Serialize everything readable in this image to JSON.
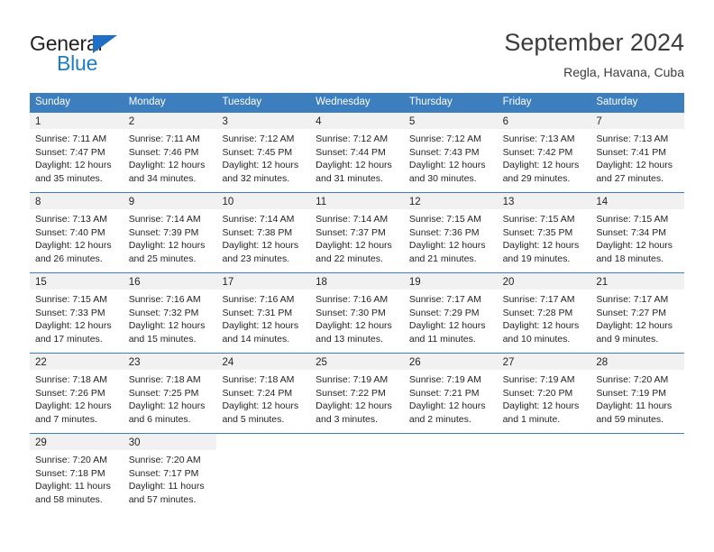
{
  "brand": {
    "name_part1": "General",
    "name_part2": "Blue",
    "accent_color": "#1f7cc4"
  },
  "header": {
    "title": "September 2024",
    "subtitle": "Regla, Havana, Cuba"
  },
  "theme": {
    "header_bg": "#3c7ebe",
    "daynum_bg": "#f1f1f1",
    "text": "#231f20"
  },
  "weekdays": [
    "Sunday",
    "Monday",
    "Tuesday",
    "Wednesday",
    "Thursday",
    "Friday",
    "Saturday"
  ],
  "weeks": [
    [
      {
        "day": "1",
        "sunrise": "Sunrise: 7:11 AM",
        "sunset": "Sunset: 7:47 PM",
        "daylight1": "Daylight: 12 hours",
        "daylight2": "and 35 minutes."
      },
      {
        "day": "2",
        "sunrise": "Sunrise: 7:11 AM",
        "sunset": "Sunset: 7:46 PM",
        "daylight1": "Daylight: 12 hours",
        "daylight2": "and 34 minutes."
      },
      {
        "day": "3",
        "sunrise": "Sunrise: 7:12 AM",
        "sunset": "Sunset: 7:45 PM",
        "daylight1": "Daylight: 12 hours",
        "daylight2": "and 32 minutes."
      },
      {
        "day": "4",
        "sunrise": "Sunrise: 7:12 AM",
        "sunset": "Sunset: 7:44 PM",
        "daylight1": "Daylight: 12 hours",
        "daylight2": "and 31 minutes."
      },
      {
        "day": "5",
        "sunrise": "Sunrise: 7:12 AM",
        "sunset": "Sunset: 7:43 PM",
        "daylight1": "Daylight: 12 hours",
        "daylight2": "and 30 minutes."
      },
      {
        "day": "6",
        "sunrise": "Sunrise: 7:13 AM",
        "sunset": "Sunset: 7:42 PM",
        "daylight1": "Daylight: 12 hours",
        "daylight2": "and 29 minutes."
      },
      {
        "day": "7",
        "sunrise": "Sunrise: 7:13 AM",
        "sunset": "Sunset: 7:41 PM",
        "daylight1": "Daylight: 12 hours",
        "daylight2": "and 27 minutes."
      }
    ],
    [
      {
        "day": "8",
        "sunrise": "Sunrise: 7:13 AM",
        "sunset": "Sunset: 7:40 PM",
        "daylight1": "Daylight: 12 hours",
        "daylight2": "and 26 minutes."
      },
      {
        "day": "9",
        "sunrise": "Sunrise: 7:14 AM",
        "sunset": "Sunset: 7:39 PM",
        "daylight1": "Daylight: 12 hours",
        "daylight2": "and 25 minutes."
      },
      {
        "day": "10",
        "sunrise": "Sunrise: 7:14 AM",
        "sunset": "Sunset: 7:38 PM",
        "daylight1": "Daylight: 12 hours",
        "daylight2": "and 23 minutes."
      },
      {
        "day": "11",
        "sunrise": "Sunrise: 7:14 AM",
        "sunset": "Sunset: 7:37 PM",
        "daylight1": "Daylight: 12 hours",
        "daylight2": "and 22 minutes."
      },
      {
        "day": "12",
        "sunrise": "Sunrise: 7:15 AM",
        "sunset": "Sunset: 7:36 PM",
        "daylight1": "Daylight: 12 hours",
        "daylight2": "and 21 minutes."
      },
      {
        "day": "13",
        "sunrise": "Sunrise: 7:15 AM",
        "sunset": "Sunset: 7:35 PM",
        "daylight1": "Daylight: 12 hours",
        "daylight2": "and 19 minutes."
      },
      {
        "day": "14",
        "sunrise": "Sunrise: 7:15 AM",
        "sunset": "Sunset: 7:34 PM",
        "daylight1": "Daylight: 12 hours",
        "daylight2": "and 18 minutes."
      }
    ],
    [
      {
        "day": "15",
        "sunrise": "Sunrise: 7:15 AM",
        "sunset": "Sunset: 7:33 PM",
        "daylight1": "Daylight: 12 hours",
        "daylight2": "and 17 minutes."
      },
      {
        "day": "16",
        "sunrise": "Sunrise: 7:16 AM",
        "sunset": "Sunset: 7:32 PM",
        "daylight1": "Daylight: 12 hours",
        "daylight2": "and 15 minutes."
      },
      {
        "day": "17",
        "sunrise": "Sunrise: 7:16 AM",
        "sunset": "Sunset: 7:31 PM",
        "daylight1": "Daylight: 12 hours",
        "daylight2": "and 14 minutes."
      },
      {
        "day": "18",
        "sunrise": "Sunrise: 7:16 AM",
        "sunset": "Sunset: 7:30 PM",
        "daylight1": "Daylight: 12 hours",
        "daylight2": "and 13 minutes."
      },
      {
        "day": "19",
        "sunrise": "Sunrise: 7:17 AM",
        "sunset": "Sunset: 7:29 PM",
        "daylight1": "Daylight: 12 hours",
        "daylight2": "and 11 minutes."
      },
      {
        "day": "20",
        "sunrise": "Sunrise: 7:17 AM",
        "sunset": "Sunset: 7:28 PM",
        "daylight1": "Daylight: 12 hours",
        "daylight2": "and 10 minutes."
      },
      {
        "day": "21",
        "sunrise": "Sunrise: 7:17 AM",
        "sunset": "Sunset: 7:27 PM",
        "daylight1": "Daylight: 12 hours",
        "daylight2": "and 9 minutes."
      }
    ],
    [
      {
        "day": "22",
        "sunrise": "Sunrise: 7:18 AM",
        "sunset": "Sunset: 7:26 PM",
        "daylight1": "Daylight: 12 hours",
        "daylight2": "and 7 minutes."
      },
      {
        "day": "23",
        "sunrise": "Sunrise: 7:18 AM",
        "sunset": "Sunset: 7:25 PM",
        "daylight1": "Daylight: 12 hours",
        "daylight2": "and 6 minutes."
      },
      {
        "day": "24",
        "sunrise": "Sunrise: 7:18 AM",
        "sunset": "Sunset: 7:24 PM",
        "daylight1": "Daylight: 12 hours",
        "daylight2": "and 5 minutes."
      },
      {
        "day": "25",
        "sunrise": "Sunrise: 7:19 AM",
        "sunset": "Sunset: 7:22 PM",
        "daylight1": "Daylight: 12 hours",
        "daylight2": "and 3 minutes."
      },
      {
        "day": "26",
        "sunrise": "Sunrise: 7:19 AM",
        "sunset": "Sunset: 7:21 PM",
        "daylight1": "Daylight: 12 hours",
        "daylight2": "and 2 minutes."
      },
      {
        "day": "27",
        "sunrise": "Sunrise: 7:19 AM",
        "sunset": "Sunset: 7:20 PM",
        "daylight1": "Daylight: 12 hours",
        "daylight2": "and 1 minute."
      },
      {
        "day": "28",
        "sunrise": "Sunrise: 7:20 AM",
        "sunset": "Sunset: 7:19 PM",
        "daylight1": "Daylight: 11 hours",
        "daylight2": "and 59 minutes."
      }
    ],
    [
      {
        "day": "29",
        "sunrise": "Sunrise: 7:20 AM",
        "sunset": "Sunset: 7:18 PM",
        "daylight1": "Daylight: 11 hours",
        "daylight2": "and 58 minutes."
      },
      {
        "day": "30",
        "sunrise": "Sunrise: 7:20 AM",
        "sunset": "Sunset: 7:17 PM",
        "daylight1": "Daylight: 11 hours",
        "daylight2": "and 57 minutes."
      },
      {
        "day": "",
        "sunrise": "",
        "sunset": "",
        "daylight1": "",
        "daylight2": ""
      },
      {
        "day": "",
        "sunrise": "",
        "sunset": "",
        "daylight1": "",
        "daylight2": ""
      },
      {
        "day": "",
        "sunrise": "",
        "sunset": "",
        "daylight1": "",
        "daylight2": ""
      },
      {
        "day": "",
        "sunrise": "",
        "sunset": "",
        "daylight1": "",
        "daylight2": ""
      },
      {
        "day": "",
        "sunrise": "",
        "sunset": "",
        "daylight1": "",
        "daylight2": ""
      }
    ]
  ]
}
